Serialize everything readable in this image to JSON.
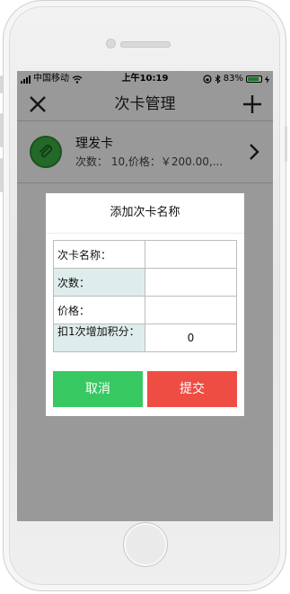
{
  "status_bar": {
    "carrier": "中国移动",
    "time": "上午10:19",
    "battery_percent": "83%",
    "battery_level": 0.83
  },
  "navbar": {
    "title": "次卡管理",
    "close_icon": "close-icon",
    "add_icon": "plus-icon"
  },
  "list": {
    "items": [
      {
        "name": "理发卡",
        "detail": "次数：  10,价格：￥200.00,...",
        "icon": "paperclip-icon"
      }
    ]
  },
  "dialog": {
    "title": "添加次卡名称",
    "fields": [
      {
        "label": "次卡名称：",
        "value": ""
      },
      {
        "label": "次数：",
        "value": ""
      },
      {
        "label": "价格：",
        "value": ""
      },
      {
        "label": "扣1次增加积分：",
        "value": "0"
      }
    ],
    "cancel_label": "取消",
    "submit_label": "提交"
  },
  "colors": {
    "cancel": "#37c862",
    "submit": "#ee4d43",
    "item_icon": "#3cb043",
    "field_shade": "#deecec"
  }
}
